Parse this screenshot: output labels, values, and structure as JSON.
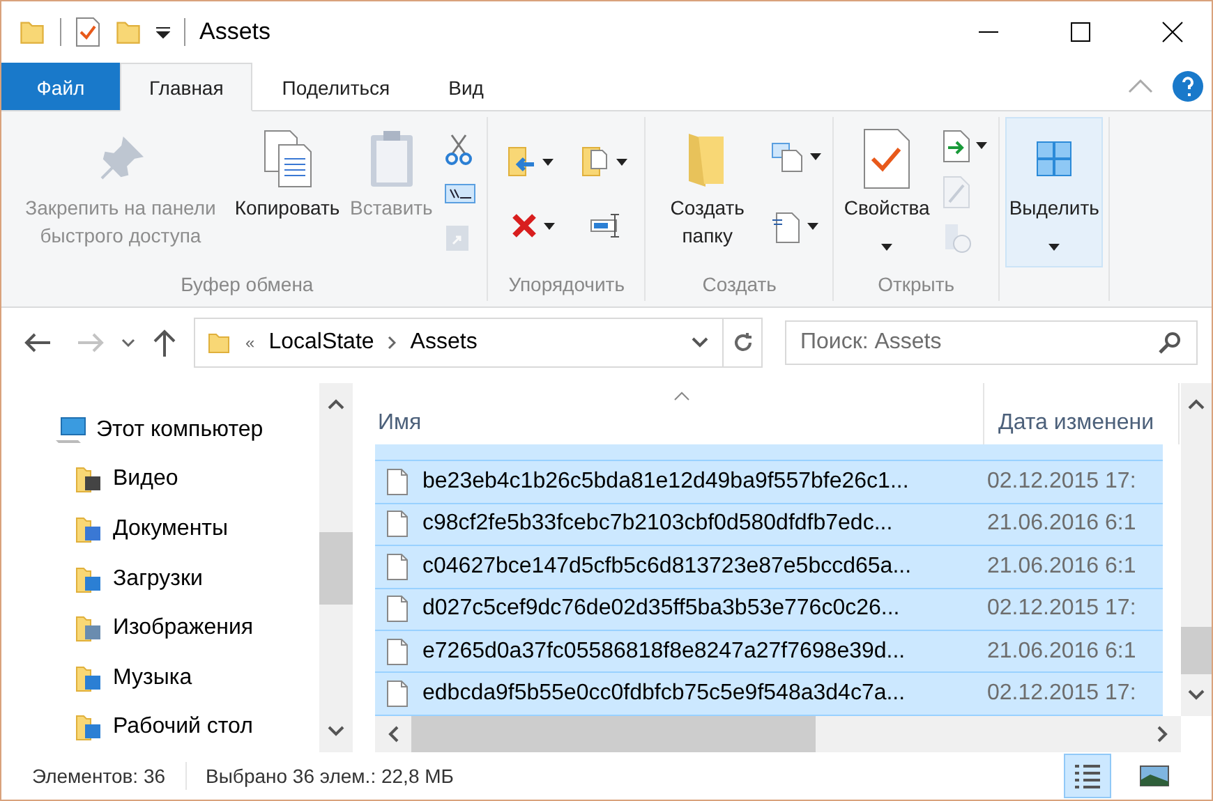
{
  "window": {
    "title": "Assets"
  },
  "quick_access": [
    {
      "kind": "properties"
    },
    {
      "kind": "new-folder"
    },
    {
      "kind": "customize"
    }
  ],
  "tabs": [
    {
      "label": "Файл",
      "kind": "file",
      "selected": false
    },
    {
      "label": "Главная",
      "kind": "tab",
      "selected": true
    },
    {
      "label": "Поделиться",
      "kind": "tab",
      "selected": false
    },
    {
      "label": "Вид",
      "kind": "tab",
      "selected": false
    }
  ],
  "ribbon": {
    "groups": [
      {
        "label": "Буфер обмена",
        "large": [
          {
            "label": "Закрепить на панели быстрого доступа",
            "disabled": true,
            "dropdown": false,
            "selected": false
          },
          {
            "label": "Копировать",
            "disabled": false,
            "dropdown": false,
            "selected": false
          },
          {
            "label": "Вставить",
            "disabled": true,
            "dropdown": false,
            "selected": false
          }
        ],
        "small": [
          {
            "disabled": false,
            "dropdown": false
          },
          {
            "disabled": false,
            "dropdown": false
          },
          {
            "disabled": true,
            "dropdown": false
          }
        ]
      },
      {
        "label": "Упорядочить",
        "small": [
          {
            "disabled": false,
            "dropdown": true
          },
          {
            "disabled": false,
            "dropdown": true
          },
          {
            "disabled": false,
            "dropdown": true
          },
          {
            "disabled": false,
            "dropdown": false
          }
        ]
      },
      {
        "label": "Создать",
        "large": [
          {
            "label": "Создать папку",
            "disabled": false,
            "dropdown": false,
            "selected": false
          }
        ],
        "small": [
          {
            "disabled": false,
            "dropdown": true
          },
          {
            "disabled": false,
            "dropdown": true
          }
        ]
      },
      {
        "label": "Открыть",
        "large": [
          {
            "label": "Свойства",
            "disabled": false,
            "dropdown": true,
            "selected": false
          }
        ],
        "small": [
          {
            "disabled": false,
            "dropdown": true
          },
          {
            "disabled": true,
            "dropdown": false
          },
          {
            "disabled": true,
            "dropdown": false
          }
        ]
      },
      {
        "large": [
          {
            "label": "Выделить",
            "disabled": false,
            "dropdown": true,
            "selected": true
          }
        ]
      }
    ]
  },
  "navigation": {
    "back_disabled": false,
    "forward_disabled": true
  },
  "address": {
    "overflow": "«",
    "segments": [
      "LocalState",
      "Assets"
    ]
  },
  "search": {
    "placeholder": "Поиск: Assets"
  },
  "sidebar": {
    "items": [
      {
        "label": "Этот компьютер",
        "children": [
          {
            "label": "Видео"
          },
          {
            "label": "Документы"
          },
          {
            "label": "Загрузки"
          },
          {
            "label": "Изображения"
          },
          {
            "label": "Музыка"
          },
          {
            "label": "Рабочий стол"
          }
        ]
      }
    ]
  },
  "table": {
    "columns": [
      "Имя",
      "Дата изменени"
    ],
    "rows": [
      {
        "name": "be23eb4c1b26c5bda81e12d49ba9f557bfe26c1...",
        "date": "02.12.2015 17:",
        "selected": true
      },
      {
        "name": "c98cf2fe5b33fcebc7b2103cbf0d580dfdfb7edc...",
        "date": "21.06.2016 6:1",
        "selected": true
      },
      {
        "name": "c04627bce147d5cfb5c6d813723e87e5bccd65a...",
        "date": "21.06.2016 6:1",
        "selected": true
      },
      {
        "name": "d027c5cef9dc76de02d35ff5ba3b53e776c0c26...",
        "date": "02.12.2015 17:",
        "selected": true
      },
      {
        "name": "e7265d0a37fc05586818f8e8247a27f7698e39d...",
        "date": "21.06.2016 6:1",
        "selected": true
      },
      {
        "name": "edbcda9f5b55e0cc0fdbfcb75c5e9f548a3d4c7a...",
        "date": "02.12.2015 17:",
        "selected": true
      }
    ]
  },
  "status_bar": {
    "items": "Элементов: 36",
    "selection": "Выбрано 36 элем.: 22,8 МБ"
  },
  "views": [
    {
      "kind": "details",
      "selected": true
    },
    {
      "kind": "tiles",
      "selected": false
    }
  ]
}
